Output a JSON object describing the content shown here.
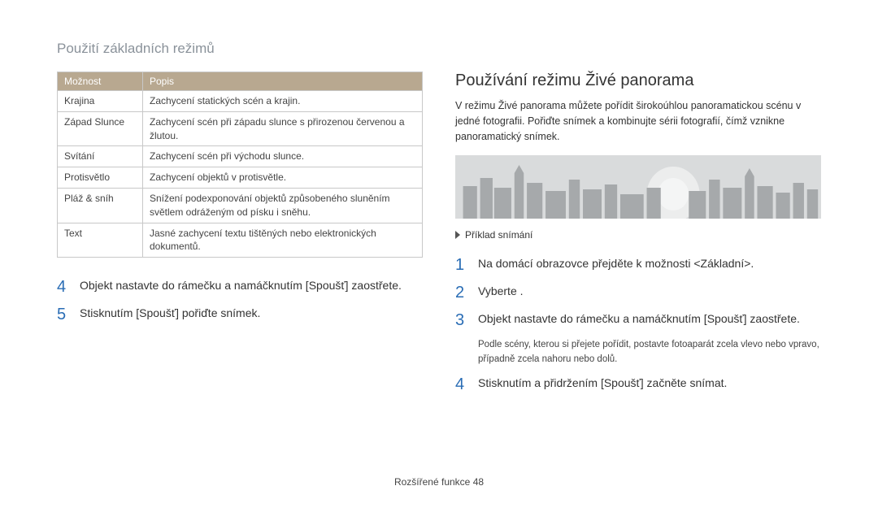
{
  "header": {
    "breadcrumb": "Použití základních režimů"
  },
  "table": {
    "col1": "Možnost",
    "col2": "Popis",
    "rows": [
      {
        "opt": "Krajina",
        "desc": "Zachycení statických scén a krajin."
      },
      {
        "opt": "Západ Slunce",
        "desc": "Zachycení scén při západu slunce s přirozenou červenou a žlutou."
      },
      {
        "opt": "Svítání",
        "desc": "Zachycení scén při východu slunce."
      },
      {
        "opt": "Protisvětlo",
        "desc": "Zachycení objektů v protisvětle."
      },
      {
        "opt": "Pláž & sníh",
        "desc": "Snížení podexponování objektů způsobeného sluněním světlem odráženým od písku i sněhu."
      },
      {
        "opt": "Text",
        "desc": "Jasné zachycení textu tištěných nebo elektronických dokumentů."
      }
    ]
  },
  "left_steps": [
    {
      "n": "4",
      "t": "Objekt nastavte do rámečku a namáčknutím [Spoušť] zaostřete."
    },
    {
      "n": "5",
      "t": "Stisknutím [Spoušť] pořiďte snímek."
    }
  ],
  "right": {
    "heading": "Používání režimu Živé panorama",
    "intro": "V režimu Živé panorama můžete pořídit širokoúhlou panoramatickou scénu v jedné fotografii. Pořiďte snímek a kombinujte sérii fotografií, čímž vznikne panoramatický snímek.",
    "caption": "Příklad snímání",
    "steps": [
      {
        "n": "1",
        "t": "Na domácí obrazovce přejděte k možnosti <Základní>."
      },
      {
        "n": "2",
        "t": "Vyberte     ."
      },
      {
        "n": "3",
        "t": "Objekt nastavte do rámečku a namáčknutím [Spoušť] zaostřete.",
        "sub": "Podle scény, kterou si přejete pořídit, postavte fotoaparát zcela vlevo nebo vpravo, případně zcela nahoru nebo dolů."
      },
      {
        "n": "4",
        "t": "Stisknutím a přidržením [Spoušť] začněte snímat."
      }
    ]
  },
  "footer": {
    "section": "Rozšířené funkce",
    "page": "48"
  }
}
